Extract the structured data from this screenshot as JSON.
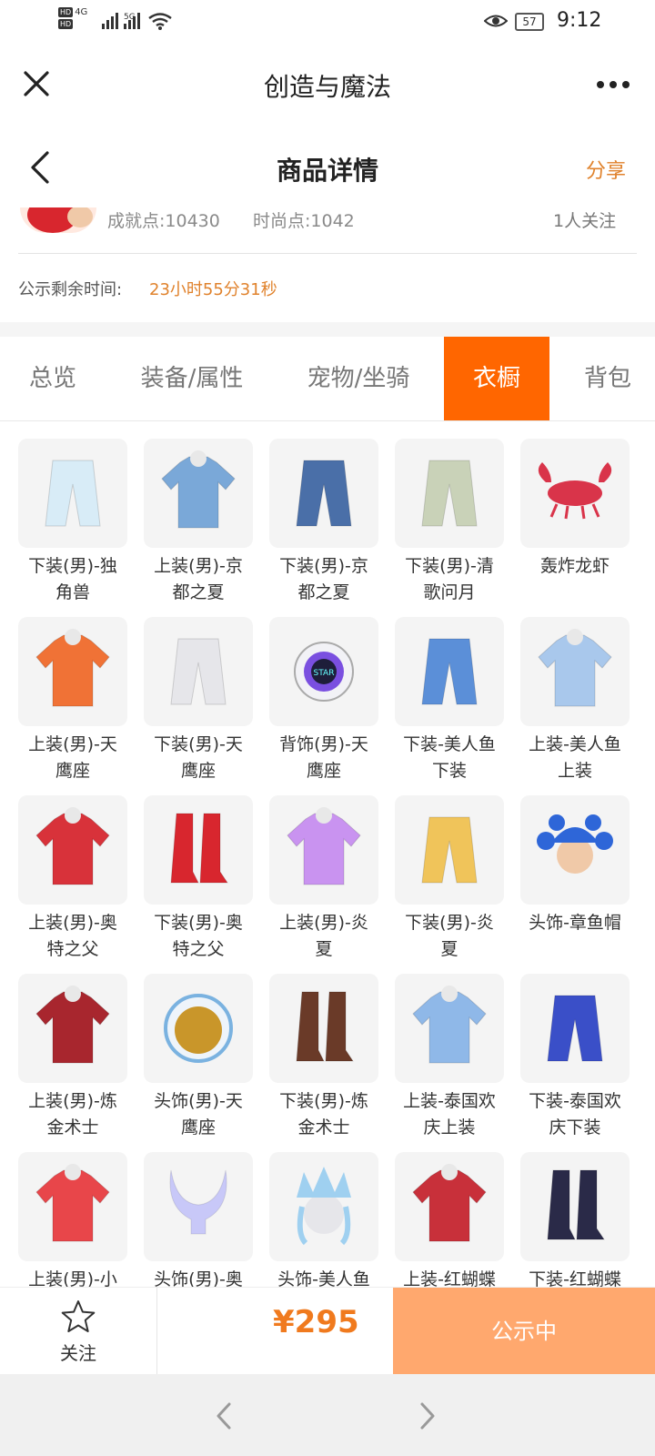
{
  "status_bar": {
    "network_left": "4G",
    "network_right": "5G",
    "battery": "57",
    "time": "9:12"
  },
  "mini_program": {
    "title": "创造与魔法"
  },
  "page": {
    "title": "商品详情",
    "share_label": "分享"
  },
  "user": {
    "achievement": "成就点:10430",
    "fashion": "时尚点:1042",
    "followers": "1人关注"
  },
  "countdown": {
    "label": "公示剩余时间:",
    "value": "23小时55分31秒"
  },
  "tabs": [
    {
      "label": "总览"
    },
    {
      "label": "装备/属性"
    },
    {
      "label": "宠物/坐骑"
    },
    {
      "label": "衣橱",
      "active": true
    },
    {
      "label": "背包"
    }
  ],
  "wardrobe": [
    {
      "name": "下装(男)-独角兽",
      "icon": "pants-icon",
      "color": "#d8ecf7"
    },
    {
      "name": "上装(男)-京都之夏",
      "icon": "shirt-icon",
      "color": "#7aa8d8"
    },
    {
      "name": "下装(男)-京都之夏",
      "icon": "pants-icon",
      "color": "#4a6fa8"
    },
    {
      "name": "下装(男)-清歌问月",
      "icon": "pants-icon",
      "color": "#c9d2b8"
    },
    {
      "name": "轰炸龙虾",
      "icon": "lobster-icon",
      "color": "#d9344a"
    },
    {
      "name": "上装(男)-天鹰座",
      "icon": "shirt-icon",
      "color": "#f07236"
    },
    {
      "name": "下装(男)-天鹰座",
      "icon": "pants-icon",
      "color": "#e6e6ea"
    },
    {
      "name": "背饰(男)-天鹰座",
      "icon": "backpack-icon",
      "color": "#7a4fe0"
    },
    {
      "name": "下装-美人鱼下装",
      "icon": "pants-icon",
      "color": "#5b8fd8"
    },
    {
      "name": "上装-美人鱼上装",
      "icon": "shirt-icon",
      "color": "#a9c8ec"
    },
    {
      "name": "上装(男)-奥特之父",
      "icon": "shirt-icon",
      "color": "#d8323a"
    },
    {
      "name": "下装(男)-奥特之父",
      "icon": "boots-icon",
      "color": "#d8262e"
    },
    {
      "name": "上装(男)-炎夏",
      "icon": "shirt-icon",
      "color": "#c993f0"
    },
    {
      "name": "下装(男)-炎夏",
      "icon": "pants-icon",
      "color": "#f0c45a"
    },
    {
      "name": "头饰-章鱼帽",
      "icon": "hat-icon",
      "color": "#2e66d8"
    },
    {
      "name": "上装(男)-炼金术士",
      "icon": "shirt-icon",
      "color": "#a8262e"
    },
    {
      "name": "头饰(男)-天鹰座",
      "icon": "helmet-icon",
      "color": "#c9962a"
    },
    {
      "name": "下装(男)-炼金术士",
      "icon": "boots-icon",
      "color": "#6a3a28"
    },
    {
      "name": "上装-泰国欢庆上装",
      "icon": "shirt-icon",
      "color": "#8fb8e8"
    },
    {
      "name": "下装-泰国欢庆下装",
      "icon": "pants-icon",
      "color": "#3a4fc8"
    },
    {
      "name": "上装(男)-小",
      "icon": "shirt-icon",
      "color": "#e8464a"
    },
    {
      "name": "头饰(男)-奥",
      "icon": "horns-icon",
      "color": "#c8c8f8"
    },
    {
      "name": "头饰-美人鱼",
      "icon": "crown-icon",
      "color": "#9fd0f0"
    },
    {
      "name": "上装-红蝴蝶",
      "icon": "shirt-icon",
      "color": "#c8303a"
    },
    {
      "name": "下装-红蝴蝶",
      "icon": "boots-icon",
      "color": "#2a2a48"
    }
  ],
  "action_bar": {
    "follow_label": "关注",
    "price": "¥295",
    "status_label": "公示中"
  },
  "colors": {
    "accent": "#ff6600",
    "price": "#f07a1e",
    "status_button": "#ffa86e",
    "highlight_text": "#e0822c"
  }
}
